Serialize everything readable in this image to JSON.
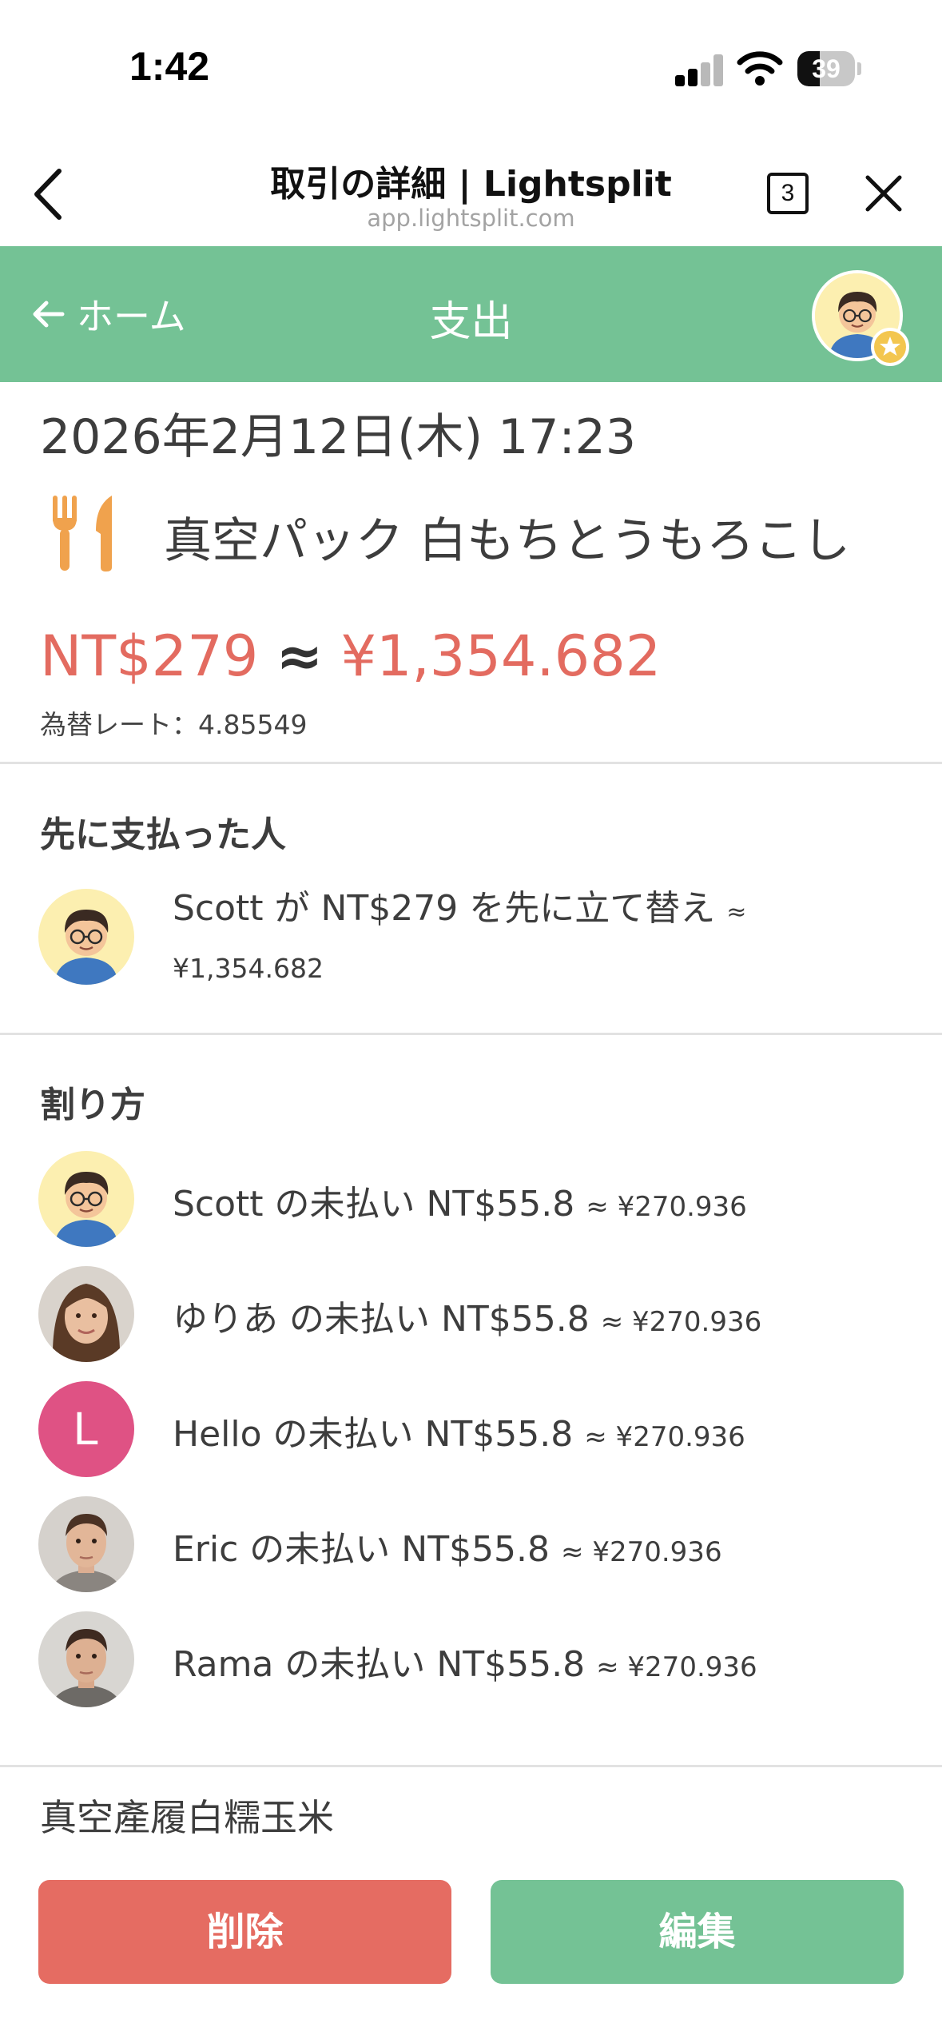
{
  "status_bar": {
    "time": "1:42",
    "battery": "39",
    "battery_level": 0.39
  },
  "browser": {
    "title": "取引の詳細 | Lightsplit",
    "url": "app.lightsplit.com",
    "tab_count": "3",
    "icons": {
      "back": "chevron-left-icon",
      "tabs": "tabs-icon",
      "close": "close-icon"
    }
  },
  "header": {
    "back_label": "ホーム",
    "title": "支出",
    "accent_color": "#74c295"
  },
  "transaction": {
    "datetime": "2026年2月12日(木) 17:23",
    "category_icon": "fork-knife-icon",
    "name": "真空パック 白もちとうもろこし",
    "amount_ntd": "NT$279",
    "approx": "≈",
    "amount_jpy": "¥1,354.682",
    "rate": "為替レート：4.85549",
    "amount_color": "#e36b60"
  },
  "payer_section": {
    "title": "先に支払った人",
    "payer": {
      "text": "Scott が NT$279 を先に立て替え",
      "approx": "≈",
      "jpy": "¥1,354.682"
    }
  },
  "split_section": {
    "title": "割り方",
    "members": [
      {
        "main": "Scott の未払い NT$55.8",
        "approx": "≈ ¥270.936",
        "avatar": "cartoon"
      },
      {
        "main": "ゆりあ の未払い NT$55.8",
        "approx": "≈ ¥270.936",
        "avatar": "photo-girl"
      },
      {
        "main": "Hello の未払い NT$55.8",
        "approx": "≈ ¥270.936",
        "avatar": "letter",
        "initial": "L"
      },
      {
        "main": "Eric の未払い NT$55.8",
        "approx": "≈ ¥270.936",
        "avatar": "photo-man"
      },
      {
        "main": "Rama の未払い NT$55.8",
        "approx": "≈ ¥270.936",
        "avatar": "photo-man"
      }
    ]
  },
  "memo": "真空產履白糯玉米",
  "actions": {
    "delete_label": "削除",
    "edit_label": "編集",
    "delete_color": "#e56c62",
    "edit_color": "#74c295"
  }
}
